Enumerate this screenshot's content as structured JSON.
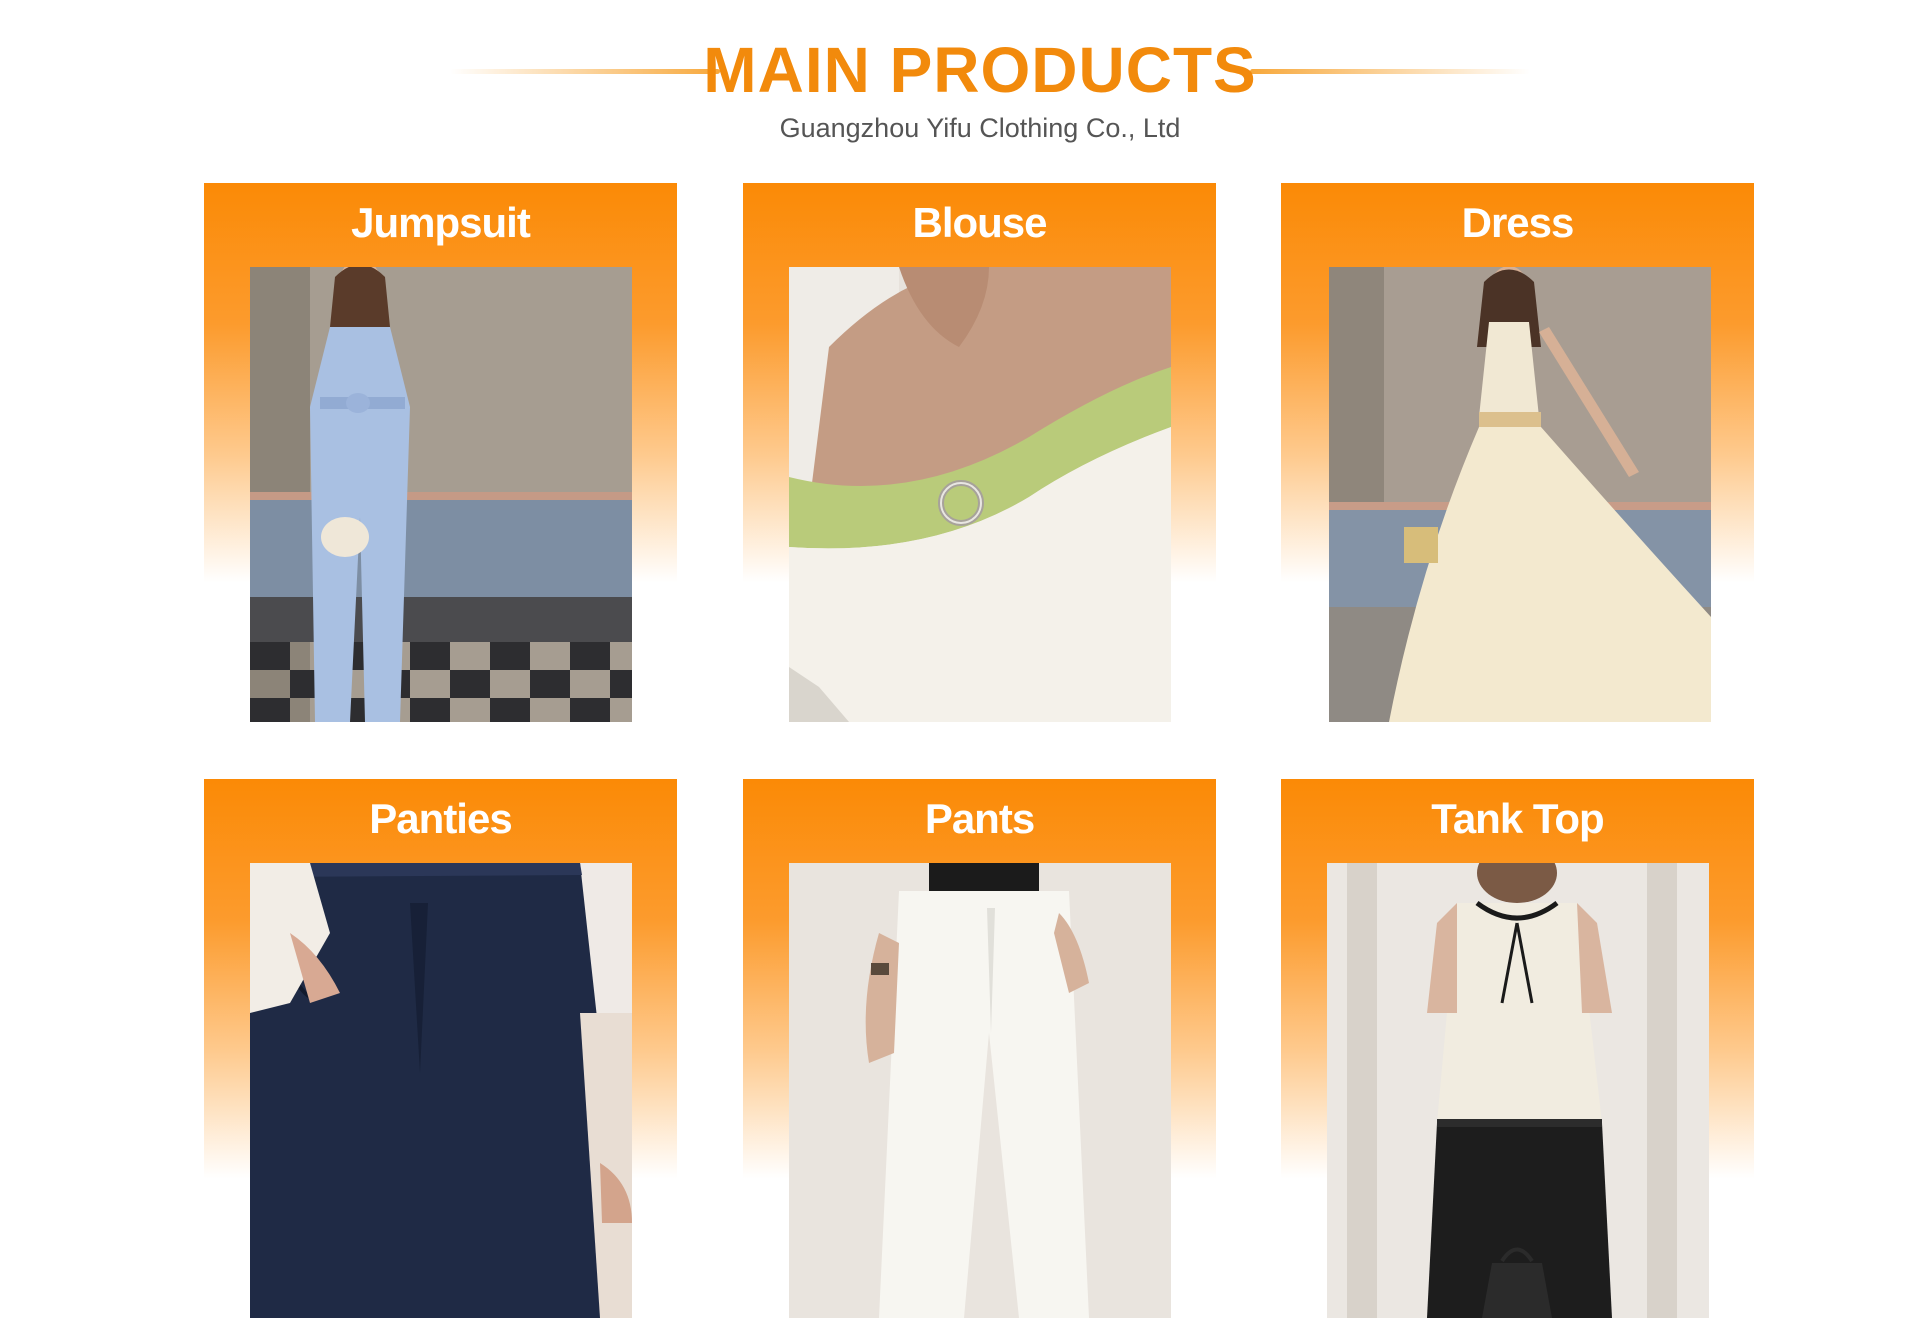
{
  "header": {
    "title": "MAIN PRODUCTS",
    "subtitle": "Guangzhou Yifu Clothing Co., Ltd",
    "accent_color": "#f28a0c"
  },
  "products": [
    {
      "label": "Jumpsuit",
      "photo_icon": "jumpsuit-photo"
    },
    {
      "label": "Blouse",
      "photo_icon": "blouse-photo"
    },
    {
      "label": "Dress",
      "photo_icon": "dress-photo"
    },
    {
      "label": "Panties",
      "photo_icon": "shorts-photo"
    },
    {
      "label": "Pants",
      "photo_icon": "pants-photo"
    },
    {
      "label": "Tank Top",
      "photo_icon": "tank-top-photo"
    }
  ]
}
